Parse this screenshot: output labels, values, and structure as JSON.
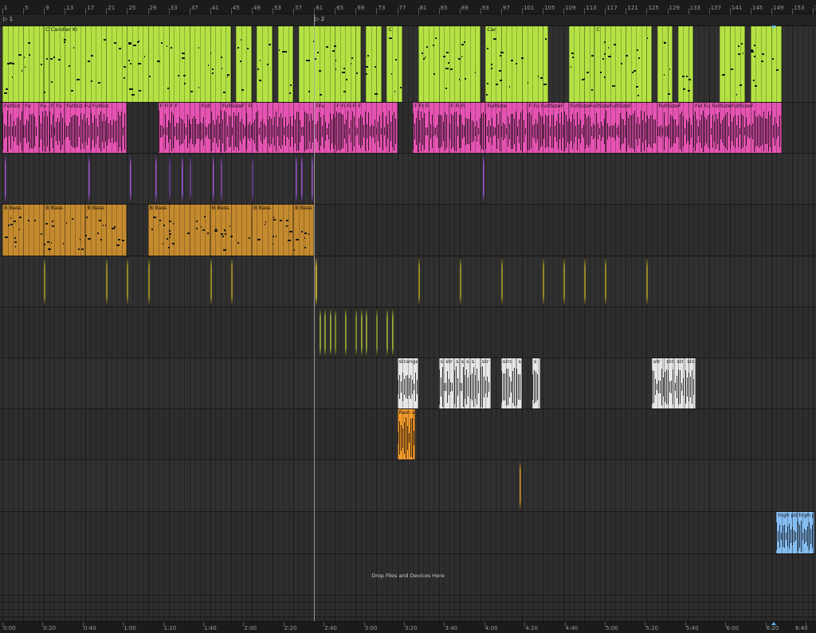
{
  "bar_ruler": {
    "labels": [
      "1",
      "5",
      "9",
      "13",
      "17",
      "21",
      "25",
      "29",
      "33",
      "37",
      "41",
      "45",
      "49",
      "53",
      "57",
      "61",
      "65",
      "69",
      "73",
      "77",
      "81",
      "85",
      "89",
      "93",
      "97",
      "101",
      "105",
      "109",
      "113",
      "117",
      "121",
      "125",
      "129",
      "133",
      "137",
      "141",
      "145",
      "149",
      "153",
      "157"
    ]
  },
  "time_ruler": {
    "labels": [
      "0:00",
      "0:20",
      "0:40",
      "1:00",
      "1:20",
      "1:40",
      "2:00",
      "2:20",
      "2:40",
      "3:00",
      "3:20",
      "3:40",
      "4:00",
      "4:20",
      "4:40",
      "5:00",
      "5:20",
      "5:40",
      "6:00",
      "6:20",
      "6:40"
    ]
  },
  "locators": [
    {
      "label": "1",
      "bar": 1
    },
    {
      "label": "2",
      "bar": 61
    }
  ],
  "tracks": [
    {
      "id": "t1",
      "color": "#b4e244",
      "type": "midi",
      "clips": [
        {
          "start": 1,
          "end": 9,
          "label": ""
        },
        {
          "start": 9,
          "end": 10,
          "label": "Car"
        },
        {
          "start": 10,
          "end": 45,
          "label": "Candler Ki"
        },
        {
          "start": 46,
          "end": 49,
          "label": ""
        },
        {
          "start": 50,
          "end": 53,
          "label": ""
        },
        {
          "start": 54,
          "end": 57,
          "label": ""
        },
        {
          "start": 58,
          "end": 70,
          "label": ""
        },
        {
          "start": 71,
          "end": 74,
          "label": ""
        },
        {
          "start": 75,
          "end": 78,
          "label": "C"
        },
        {
          "start": 81,
          "end": 93,
          "label": ""
        },
        {
          "start": 94,
          "end": 106,
          "label": "Car"
        },
        {
          "start": 110,
          "end": 115,
          "label": ""
        },
        {
          "start": 115,
          "end": 126,
          "label": "C"
        },
        {
          "start": 127,
          "end": 130,
          "label": ""
        },
        {
          "start": 131,
          "end": 134,
          "label": ""
        },
        {
          "start": 139,
          "end": 144,
          "label": ""
        },
        {
          "start": 145,
          "end": 151,
          "label": ""
        }
      ]
    },
    {
      "id": "t2",
      "color": "#e554b2",
      "type": "audio",
      "clips": [
        {
          "start": 1,
          "end": 5,
          "label": "FullSiz"
        },
        {
          "start": 5,
          "end": 8,
          "label": "Fu"
        },
        {
          "start": 8,
          "end": 10,
          "label": "Fu"
        },
        {
          "start": 10,
          "end": 11,
          "label": "Fu"
        },
        {
          "start": 11,
          "end": 13,
          "label": "Fu"
        },
        {
          "start": 13,
          "end": 18,
          "label": "FullSiz Fu"
        },
        {
          "start": 18,
          "end": 25,
          "label": "FullSiz"
        },
        {
          "start": 31,
          "end": 39,
          "label": "F Fi F F"
        },
        {
          "start": 39,
          "end": 43,
          "label": "Full"
        },
        {
          "start": 43,
          "end": 48,
          "label": "FullSizeF"
        },
        {
          "start": 48,
          "end": 52,
          "label": "Fi"
        },
        {
          "start": 52,
          "end": 61,
          "label": ""
        },
        {
          "start": 61,
          "end": 65,
          "label": "FFu"
        },
        {
          "start": 65,
          "end": 77,
          "label": "F Fi Fi Fi F"
        },
        {
          "start": 80,
          "end": 87,
          "label": "F FI Fi"
        },
        {
          "start": 87,
          "end": 94,
          "label": "F Fi Fi"
        },
        {
          "start": 94,
          "end": 102,
          "label": "FullSize"
        },
        {
          "start": 102,
          "end": 110,
          "label": "F Fu FullSizeF"
        },
        {
          "start": 110,
          "end": 127,
          "label": "FullSizeFullSizeFullSizeF"
        },
        {
          "start": 127,
          "end": 134,
          "label": "FullSizeF"
        },
        {
          "start": 134,
          "end": 151,
          "label": "Ful Fu FullSizeFullSizeF"
        }
      ]
    },
    {
      "id": "t3",
      "color": "#9b59d0",
      "type": "audio",
      "thin": true,
      "clips_at": [
        1.5,
        17.5,
        25.5,
        30.5,
        33,
        35.5,
        37,
        41.5,
        43,
        49,
        57.5,
        58.5,
        60.5,
        93.5
      ]
    },
    {
      "id": "t4",
      "color": "#c48a2e",
      "type": "midi",
      "clips": [
        {
          "start": 1,
          "end": 9,
          "label": "B Bass"
        },
        {
          "start": 9,
          "end": 17,
          "label": "B Bass"
        },
        {
          "start": 17,
          "end": 25,
          "label": "B Bass"
        },
        {
          "start": 29,
          "end": 41,
          "label": "B Bass"
        },
        {
          "start": 41,
          "end": 49,
          "label": "B Bass"
        },
        {
          "start": 49,
          "end": 57,
          "label": "B Bass"
        },
        {
          "start": 57,
          "end": 61,
          "label": "B Bass"
        }
      ]
    },
    {
      "id": "t5",
      "color": "#ecd43c",
      "type": "audio",
      "thin": true,
      "clips_at": [
        9,
        21,
        25,
        29,
        41,
        45,
        61.2,
        81,
        89,
        97,
        105,
        109,
        113,
        117,
        125
      ]
    },
    {
      "id": "t6",
      "color": "#c8d84a",
      "type": "audio",
      "thin": true,
      "clips_at": [
        62,
        63,
        64,
        65,
        67,
        69,
        70,
        71,
        73,
        75,
        76
      ]
    },
    {
      "id": "t7",
      "color": "#e6e6e6",
      "type": "audio",
      "clips": [
        {
          "start": 77,
          "end": 81,
          "label": "strange"
        },
        {
          "start": 85,
          "end": 86,
          "label": "s"
        },
        {
          "start": 86,
          "end": 88,
          "label": "str"
        },
        {
          "start": 88,
          "end": 89,
          "label": "st"
        },
        {
          "start": 89,
          "end": 90,
          "label": "s"
        },
        {
          "start": 90,
          "end": 91,
          "label": "st"
        },
        {
          "start": 91,
          "end": 93,
          "label": "s"
        },
        {
          "start": 93,
          "end": 95,
          "label": "str"
        },
        {
          "start": 97,
          "end": 100,
          "label": "strc"
        },
        {
          "start": 100,
          "end": 101,
          "label": "st"
        },
        {
          "start": 103,
          "end": 104.5,
          "label": "s"
        },
        {
          "start": 126,
          "end": 128.5,
          "label": "str"
        },
        {
          "start": 128.5,
          "end": 130.5,
          "label": "stra"
        },
        {
          "start": 130.5,
          "end": 132.5,
          "label": "str"
        },
        {
          "start": 132.5,
          "end": 134.5,
          "label": "stra"
        }
      ]
    },
    {
      "id": "t8",
      "color": "#f39a2c",
      "type": "audio",
      "clips": [
        {
          "start": 77,
          "end": 80.5,
          "label": "Rain ar"
        }
      ]
    },
    {
      "id": "t9",
      "color": "#d79a2a",
      "type": "audio",
      "thin": true,
      "clips_at": [
        100.5
      ]
    },
    {
      "id": "t10",
      "color": "#86bdf3",
      "type": "audio",
      "clips": [
        {
          "start": 150,
          "end": 154,
          "label": "high pitch"
        },
        {
          "start": 154,
          "end": 159,
          "label": "high p"
        }
      ]
    }
  ],
  "drop_zone": {
    "label": "Drop Files and Devices Here"
  },
  "playhead_bar": 61
}
